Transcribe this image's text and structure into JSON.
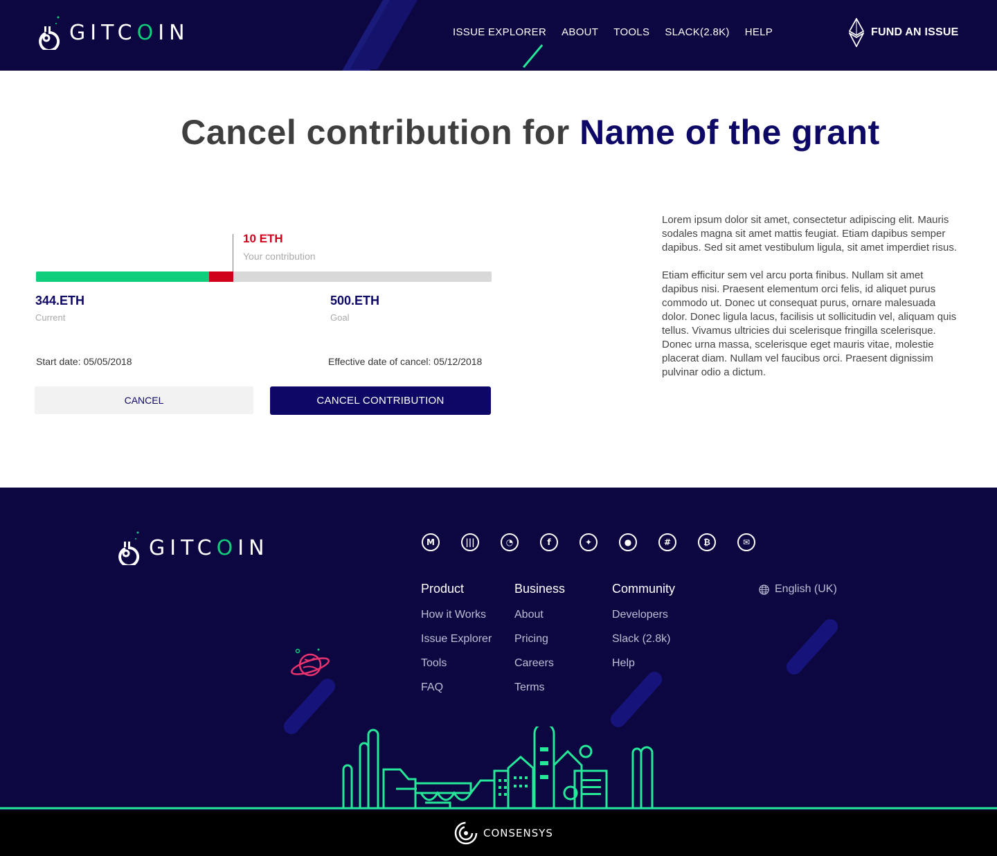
{
  "header": {
    "logo_text_pre": "GITC",
    "logo_text_o": "O",
    "logo_text_post": "IN",
    "nav": [
      "ISSUE EXPLORER",
      "ABOUT",
      "TOOLS",
      "SLACK(2.8K)",
      "HELP"
    ],
    "fund_label": "FUND AN ISSUE"
  },
  "page": {
    "title_prefix": "Cancel contribution for ",
    "title_grant": "Name of the grant"
  },
  "contribution": {
    "amount": "10 ETH",
    "amount_label": "Your contribution",
    "current_value": "344.ETH",
    "current_label": "Current",
    "goal_value": "500.ETH",
    "goal_label": "Goal",
    "progress": {
      "current_fraction": 0.38,
      "contribution_fraction": 0.053
    },
    "start_date": "Start date: 05/05/2018",
    "cancel_date": "Effective date of cancel: 05/12/2018",
    "cancel_button": "CANCEL",
    "confirm_button": "CANCEL CONTRIBUTION"
  },
  "description": {
    "p1": "Lorem ipsum dolor sit amet, consectetur adipiscing elit. Mauris sodales magna sit amet mattis feugiat. Etiam dapibus semper dapibus. Sed sit amet vestibulum ligula, sit amet imperdiet risus.",
    "p2": " Etiam efficitur sem vel arcu porta finibus. Nullam sit amet dapibus nisi. Praesent elementum orci felis, id aliquet purus commodo ut. Donec ut consequat purus, ornare malesuada dolor. Donec ligula lacus, facilisis ut sollicitudin vel, aliquam quis tellus. Vivamus ultricies dui scelerisque fringilla scelerisque. Donec urna massa, scelerisque eget mauris vitae, molestie placerat diam. Nullam vel faucibus orci. Praesent dignissim pulvinar odio a dictum."
  },
  "footer": {
    "social_icons": [
      "medium-icon",
      "gitter-icon",
      "github-icon",
      "facebook-icon",
      "twitter-icon",
      "reddit-icon",
      "slack-icon",
      "bitcoin-icon",
      "email-icon"
    ],
    "columns": {
      "product": {
        "heading": "Product",
        "links": [
          "How it Works",
          "Issue Explorer",
          "Tools",
          "FAQ"
        ]
      },
      "business": {
        "heading": "Business",
        "links": [
          "About",
          "Pricing",
          "Careers",
          "Terms"
        ]
      },
      "community": {
        "heading": "Community",
        "links": [
          "Developers",
          "Slack (2.8k)",
          "Help"
        ]
      }
    },
    "language": "English (UK)",
    "consensys": "CONSENSYS"
  },
  "colors": {
    "navy": "#0d0741",
    "accent_green": "#0fce7c",
    "contribution_red": "#d0021b",
    "brand_blue": "#0d0766"
  }
}
